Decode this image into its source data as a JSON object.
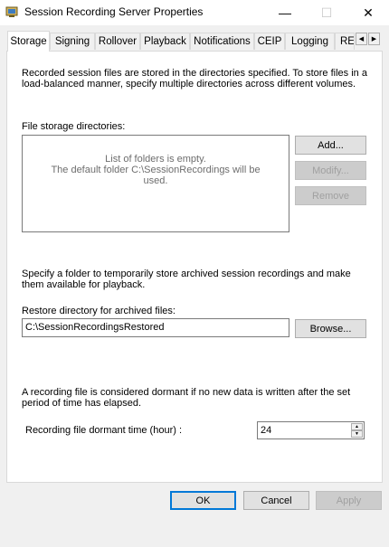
{
  "window": {
    "title": "Session Recording Server Properties",
    "minimize": "—",
    "maximize": "☐",
    "close": "✕"
  },
  "tabs": [
    {
      "label": "Storage",
      "active": true
    },
    {
      "label": "Signing"
    },
    {
      "label": "Rollover"
    },
    {
      "label": "Playback"
    },
    {
      "label": "Notifications"
    },
    {
      "label": "CEIP"
    },
    {
      "label": "Logging"
    },
    {
      "label": "RE"
    }
  ],
  "tab_scroll": {
    "left": "◀",
    "right": "▶"
  },
  "storage": {
    "intro": "Recorded session files are stored in the directories specified. To store files in a load-balanced manner, specify multiple directories across different volumes.",
    "dirs_label": "File storage directories:",
    "empty_line1": "List of folders is empty.",
    "empty_line2": "The default folder C:\\SessionRecordings will be used.",
    "add_label": "Add...",
    "modify_label": "Modify...",
    "remove_label": "Remove",
    "archive_intro": "Specify a folder to temporarily store archived session recordings and make them available for playback.",
    "restore_label": "Restore directory for archived files:",
    "restore_value": "C:\\SessionRecordingsRestored",
    "browse_label": "Browse...",
    "dormant_intro": "A recording file is considered dormant if no new data is written after the set period of time has elapsed.",
    "dormant_label": "Recording file dormant time (hour) :",
    "dormant_value": "24"
  },
  "footer": {
    "ok_label": "OK",
    "cancel_label": "Cancel",
    "apply_label": "Apply"
  },
  "colors": {
    "accent": "#0078d7",
    "disabled_text": "#a0a0a0"
  }
}
